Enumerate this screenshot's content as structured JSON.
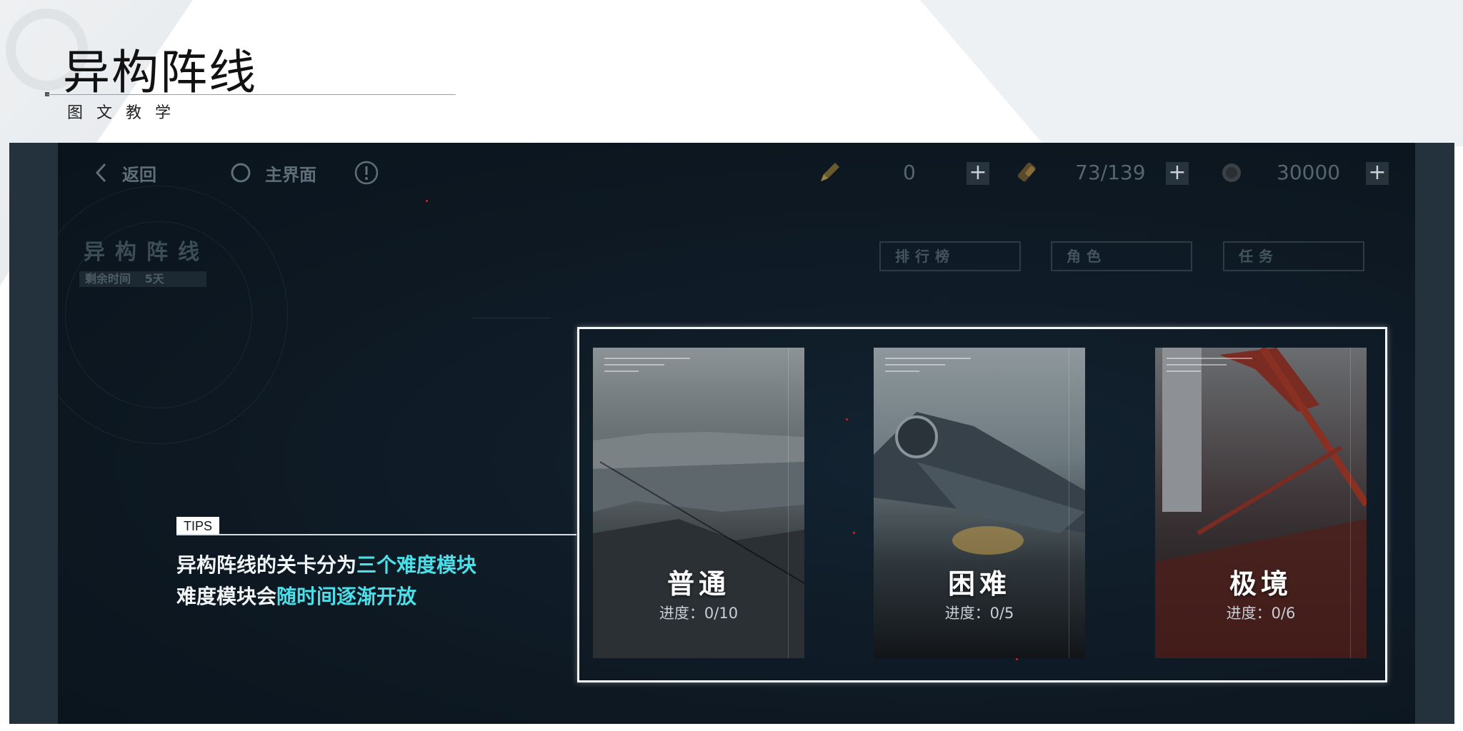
{
  "header": {
    "title": "异构阵线",
    "subtitle": "图文教学"
  },
  "topbar": {
    "back_label": "返回",
    "home_label": "主界面",
    "info_icon": "!",
    "resources": [
      {
        "icon": "pen-icon",
        "value": "0"
      },
      {
        "icon": "battery-icon",
        "value": "73/139"
      },
      {
        "icon": "coin-icon",
        "value": "30000"
      }
    ],
    "plus_label": "+"
  },
  "mode": {
    "title": "异构阵线",
    "time_label": "剩余时间",
    "time_value": "5天"
  },
  "tabs": [
    {
      "label": "排行榜"
    },
    {
      "label": "角色"
    },
    {
      "label": "任务"
    }
  ],
  "tips": {
    "badge": "TIPS",
    "line1_plain": "异构阵线的关卡分为",
    "line1_highlight": "三个难度模块",
    "line2_plain": "难度模块会",
    "line2_highlight": "随时间逐渐开放",
    "highlight_color": "#49e0ea"
  },
  "cards": [
    {
      "name": "普通",
      "progress": "进度：0/10"
    },
    {
      "name": "困难",
      "progress": "进度：0/5"
    },
    {
      "name": "极境",
      "progress": "进度：0/6"
    }
  ]
}
